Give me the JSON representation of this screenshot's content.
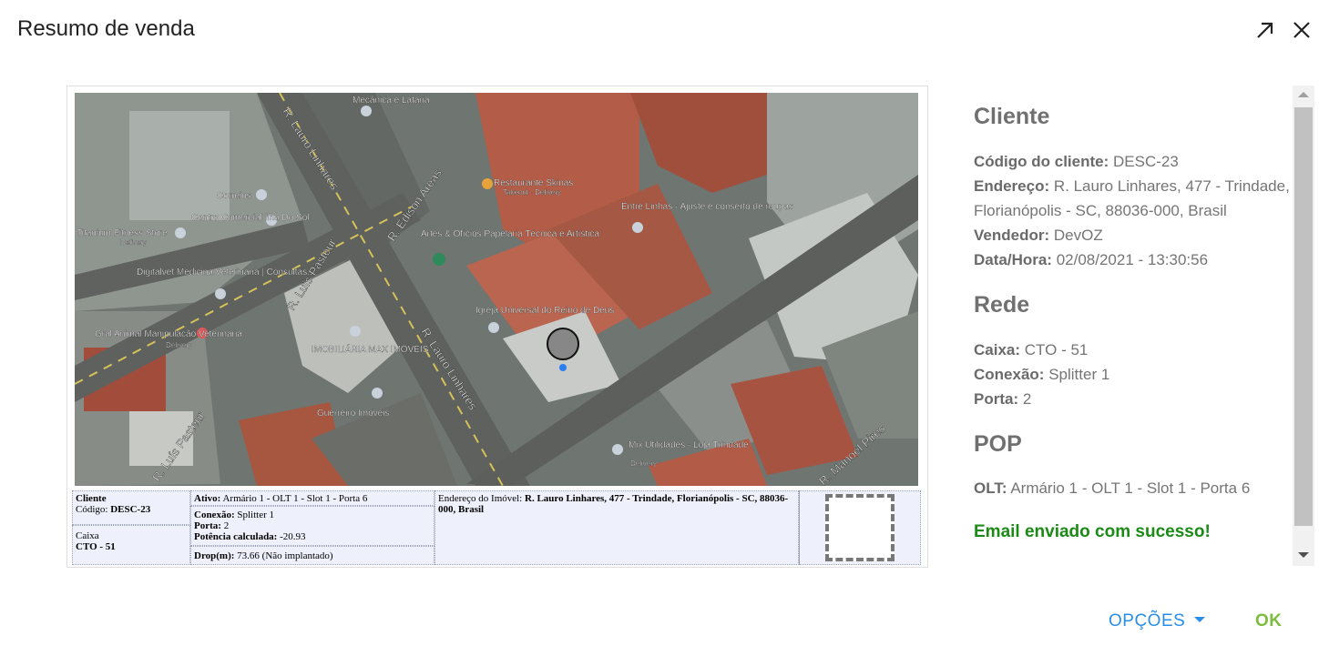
{
  "dialog": {
    "title": "Resumo de venda"
  },
  "map": {
    "labels": {
      "l1": "Mecânica e Lataria",
      "l2": "Correios",
      "l3": "Centro Comercial Ilha Do Sol",
      "l4": "Titanium Fitness Store",
      "l5": "Delivery",
      "l6": "Digitalvet Medicina Veterinária | Consultas...",
      "l7": "Gral Animal Manipulação Veterinária",
      "l8": "Delivery",
      "l9": "R. Lauro Linhares",
      "l10": "R. Luís Pasteur",
      "l11": "R. Edison Areas",
      "l12": "Restaurante Skinas",
      "l13": "Takeout · Delivery",
      "l14": "Entre Linhas - Ajuste e conserto de roupas",
      "l15": "Artes & Ofícios Papelaria Técnica e Artística",
      "l16": "Igreja Universal do Reino de Deus",
      "l17": "IMOBILIÁRIA MAX IMÓVEIS",
      "l18": "Guerreiro Imóveis",
      "l19": "R. Lauro Linhares",
      "l20": "R. Luís Pasteur",
      "l21": "Mix Utilidades - Loja Trindade",
      "l22": "Delivery",
      "l23": "R. Manoel Pires"
    },
    "table": {
      "cliente_label": "Cliente",
      "codigo_label": "Código:",
      "codigo_value": "DESC-23",
      "caixa_label": "Caixa",
      "caixa_value": "CTO - 51",
      "ativo_label": "Ativo:",
      "ativo_value": "Armário 1 - OLT 1 - Slot 1 - Porta 6",
      "conexao_label": "Conexão:",
      "conexao_value": "Splitter 1",
      "porta_label": "Porta:",
      "porta_value": "2",
      "potencia_label": "Potência calculada:",
      "potencia_value": "-20.93",
      "drop_label": "Drop(m):",
      "drop_value": "73.66 (Não implantado)",
      "endereco_label": "Endereço do Imóvel:",
      "endereco_value": "R. Lauro Linhares, 477 - Trindade, Florianópolis - SC, 88036-000, Brasil"
    }
  },
  "summary": {
    "cliente_title": "Cliente",
    "codigo_label": "Código do cliente:",
    "codigo_value": "DESC-23",
    "endereco_label": "Endereço:",
    "endereco_value_1": "R. Lauro Linhares, 477 - Trindade,",
    "endereco_value_2": "Florianópolis - SC, 88036-000, Brasil",
    "vendedor_label": "Vendedor:",
    "vendedor_value": "DevOZ",
    "datahora_label": "Data/Hora:",
    "datahora_value": "02/08/2021 - 13:30:56",
    "rede_title": "Rede",
    "caixa_label": "Caixa:",
    "caixa_value": "CTO - 51",
    "conexao_label": "Conexão:",
    "conexao_value": "Splitter 1",
    "porta_label": "Porta:",
    "porta_value": "2",
    "pop_title": "POP",
    "olt_label": "OLT:",
    "olt_value": "Armário 1 - OLT 1 - Slot 1 - Porta 6",
    "success_message": "Email enviado com sucesso!"
  },
  "footer": {
    "opcoes_label": "OPÇÕES",
    "ok_label": "OK"
  },
  "icons": {
    "expand": "arrow-up-right-icon",
    "close": "close-icon",
    "dropdown": "caret-down-icon"
  },
  "colors": {
    "success": "#1b8a16",
    "primary": "#2a8ee8",
    "ok": "#7cbd3f"
  }
}
